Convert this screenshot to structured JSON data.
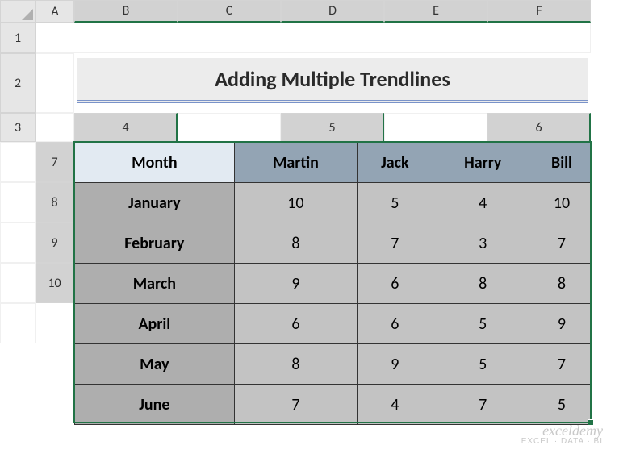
{
  "columns": [
    "A",
    "B",
    "C",
    "D",
    "E",
    "F"
  ],
  "rows": [
    "1",
    "2",
    "3",
    "4",
    "5",
    "6",
    "7",
    "8",
    "9",
    "10"
  ],
  "title": "Adding Multiple Trendlines",
  "chart_data": {
    "type": "table",
    "month_header": "Month",
    "people": [
      "Martin",
      "Jack",
      "Harry",
      "Bill"
    ],
    "months": [
      "January",
      "February",
      "March",
      "April",
      "May",
      "June"
    ],
    "values": [
      [
        10,
        5,
        4,
        10
      ],
      [
        8,
        7,
        3,
        7
      ],
      [
        9,
        6,
        8,
        8
      ],
      [
        6,
        6,
        5,
        9
      ],
      [
        8,
        9,
        5,
        7
      ],
      [
        7,
        4,
        7,
        5
      ]
    ]
  },
  "watermark": {
    "main": "exceldemy",
    "sub": "EXCEL · DATA · BI"
  }
}
